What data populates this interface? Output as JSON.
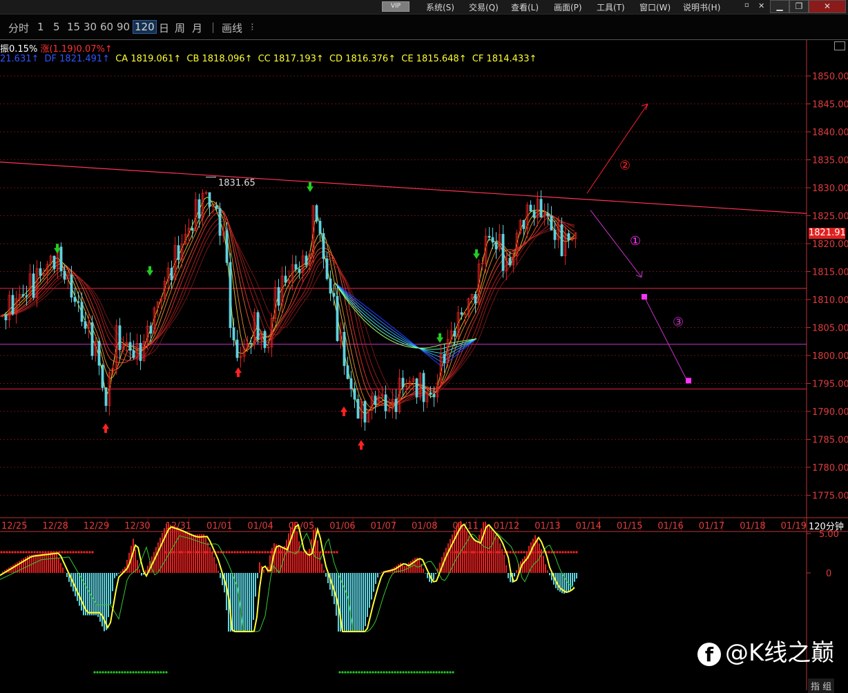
{
  "menu": {
    "vip": "VIP",
    "items": [
      "系统(S)",
      "交易(Q)",
      "查看(L)",
      "画面(P)",
      "工具(T)",
      "窗口(W)",
      "说明书(H)"
    ]
  },
  "timeframes": [
    "分时",
    "1",
    "5",
    "15",
    "30",
    "60",
    "90",
    "120",
    "日",
    "周",
    "月",
    "画线"
  ],
  "timeframe_selected": "120",
  "info_line1": {
    "amplitude": "振0.15%",
    "change_label": "涨(1.19)0.07%↑"
  },
  "info_line2": {
    "blue_a": "21.631↑",
    "blue_b": "DF 1821.491↑",
    "yellow": [
      "CA 1819.061↑",
      "CB 1818.096↑",
      "CC 1817.193↑",
      "CD 1816.376↑",
      "CE 1815.648↑",
      "CF 1814.433↑"
    ]
  },
  "price_axis": [
    "1850.00",
    "1845.00",
    "1840.00",
    "1835.00",
    "1830.00",
    "1825.00",
    "1820.00",
    "1815.00",
    "1810.00",
    "1805.00",
    "1800.00",
    "1795.00",
    "1790.00",
    "1785.00",
    "1780.00",
    "1775.00"
  ],
  "current_price": "1821.91",
  "peak_label": "1831.65",
  "date_axis": [
    "12/25",
    "12/28",
    "12/29",
    "12/30",
    "12/31",
    "01/01",
    "01/04",
    "01/05",
    "01/06",
    "01/07",
    "01/08",
    "01/11",
    "01/12",
    "01/13",
    "01/14",
    "01/15",
    "01/16",
    "01/17",
    "01/18",
    "01/19"
  ],
  "timeframe_tag": "120分钟",
  "scenario_labels": [
    "②",
    "①",
    "③"
  ],
  "oscillator_axis": [
    "5.00",
    "0"
  ],
  "watermark": "@K线之巅",
  "bottom_tabs": "指 组",
  "colors": {
    "bull": "#e02020",
    "bear": "#5fd3e0",
    "axis": "#e23c3c",
    "trendline": "#ff3355",
    "purple": "#cc33cc",
    "yellow": "#ffff33"
  },
  "icons": [
    "facebook-icon",
    "window-restore-icon",
    "window-close-icon",
    "minimize-icon"
  ]
}
